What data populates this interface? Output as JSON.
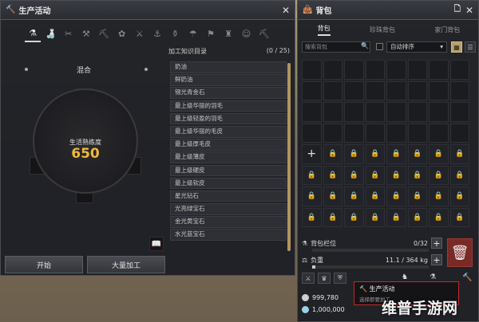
{
  "left_panel": {
    "title": "生产活动",
    "mix_label": "混合",
    "skill_label": "生活熟练度",
    "skill_value": "650",
    "list_title": "加工知识目录",
    "list_count": "(0 / 25)",
    "items": [
      "奶油",
      "鲜奶油",
      "锡光青金石",
      "最上级华丽的羽毛",
      "最上级轻盈的羽毛",
      "最上级华丽的毛皮",
      "最上级厚毛皮",
      "最上级薄皮",
      "最上级硬皮",
      "最上级软皮",
      "星光钻石",
      "光亮绿宝石",
      "金光黄宝石",
      "水光蓝宝石"
    ],
    "start_button": "开始",
    "bulk_button": "大量加工"
  },
  "right_panel": {
    "title": "背包",
    "tabs": [
      "背包",
      "珍珠背包",
      "家门背包"
    ],
    "search_placeholder": "搜索背包",
    "sort_label": "自动排序",
    "bag_slots_label": "背包栏位",
    "bag_slots_value": "0/32",
    "weight_label": "负重",
    "weight_value": "11.1 / 364 kg",
    "silver": "999,780",
    "pearls": "1,000,000"
  },
  "tooltip": {
    "title": "生产活动",
    "subtitle": "选择即要加工"
  },
  "watermark": "维普手游网"
}
